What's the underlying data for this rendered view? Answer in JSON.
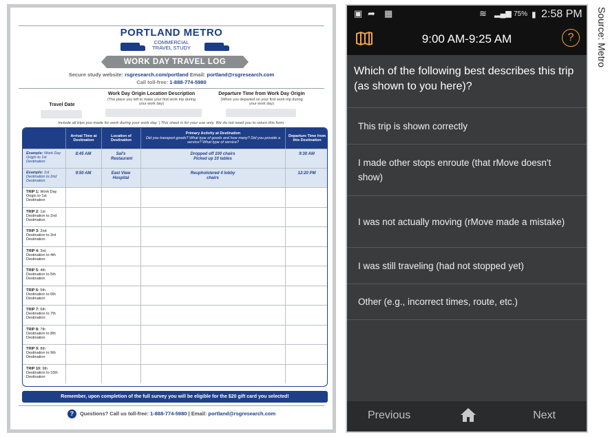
{
  "sheet": {
    "logo_title": "PORTLAND METRO",
    "logo_sub_1": "COMMERCIAL",
    "logo_sub_2": "TRAVEL STUDY",
    "banner": "WORK DAY TRAVEL LOG",
    "website_label": "Secure study website:",
    "website_url": "rsgresearch.com/portland",
    "email_label": "Email:",
    "email": "portland@rsgresearch.com",
    "tollfree_label": "Call toll-free:",
    "tollfree_number": "1-888-774-5980",
    "field_travel_date": "Travel Date",
    "field_origin": "Work Day Origin Location Description",
    "field_origin_sub": "(The place you left to make your first work trip during your work day)",
    "field_departure": "Departure Time from Work Day Origin",
    "field_departure_sub": "(When you departed on your first work trip during your work day)",
    "include_note": "Include all trips you made for work during your work day.  |  This sheet is for your use only. We do not need you to return this form.",
    "columns": [
      "",
      "Arrival Time at Destination",
      "Location of Destination",
      "Primary Activity at Destination",
      "Departure Time from this Destination"
    ],
    "primary_activity_sub": "Did you transport goods? What type of goods and how many? Did you provide a service? What type of service?",
    "examples": [
      {
        "label_b": "Example:",
        "label": "Work Day Origin to 1st Destination",
        "arrival": "8:45 AM",
        "location": "Sal's Restaurant",
        "activity": "Dropped off 100 chairs Picked up 10 tables",
        "departure": "9:30 AM"
      },
      {
        "label_b": "Example:",
        "label": "1st Destination to 2nd Destination",
        "arrival": "9:50 AM",
        "location": "East View Hospital",
        "activity": "Reupholstered 4 lobby chairs",
        "departure": "12:20 PM"
      }
    ],
    "trips": [
      {
        "label_b": "TRIP 1:",
        "label": "Work Day Origin to 1st Destination"
      },
      {
        "label_b": "TRIP 2:",
        "label": "1st Destination to 2nd Destination"
      },
      {
        "label_b": "TRIP 3:",
        "label": "2nd Destination to 3rd Destination"
      },
      {
        "label_b": "TRIP 4:",
        "label": "3rd Destination to 4th Destination"
      },
      {
        "label_b": "TRIP 5:",
        "label": "4th Destination to 5th Destination"
      },
      {
        "label_b": "TRIP 6:",
        "label": "5th Destination to 6th Destination"
      },
      {
        "label_b": "TRIP 7:",
        "label": "6th Destination to 7th Destination"
      },
      {
        "label_b": "TRIP 8:",
        "label": "7th Destination to 8th Destination"
      },
      {
        "label_b": "TRIP 9:",
        "label": "8th Destination to 9th Destination"
      },
      {
        "label_b": "TRIP 10:",
        "label": "9th Destination to 10th Destination"
      }
    ],
    "footer_bar": "Remember, upon completion of the full survey you will be eligible for the $20 gift card you selected!",
    "questions_label": "Questions? Call us toll-free:",
    "questions_number": "1-888-774-5980",
    "questions_sep": "|",
    "questions_email_label": "Email:",
    "questions_email": "portland@rsgresearch.com"
  },
  "phone": {
    "status": {
      "battery": "75%",
      "clock": "2:58 PM"
    },
    "title": "9:00 AM-9:25 AM",
    "help_glyph": "?",
    "question": "Which of the following best describes this trip (as shown to you here)?",
    "options": [
      "This trip is shown correctly",
      "I made other stops enroute (that rMove doesn't show)",
      "I was not actually moving (rMove made a mistake)",
      "I was still traveling (had not stopped yet)",
      "Other (e.g., incorrect times, route, etc.)"
    ],
    "nav": {
      "previous": "Previous",
      "next": "Next"
    },
    "accent_color": "#f2a33a"
  },
  "source_credit": "Source: Metro"
}
